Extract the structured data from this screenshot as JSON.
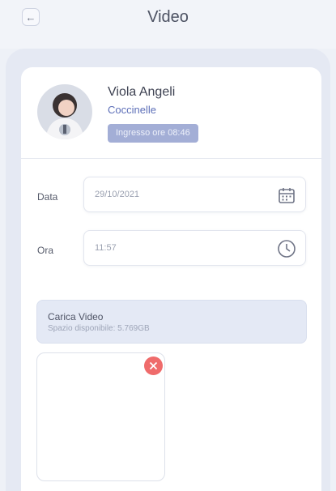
{
  "header": {
    "title": "Video",
    "back_icon": "arrow-left-icon"
  },
  "student": {
    "name": "Viola Angeli",
    "group": "Coccinelle",
    "entry_badge": "Ingresso ore 08:46"
  },
  "form": {
    "date_label": "Data",
    "date_value": "29/10/2021",
    "date_icon": "calendar-icon",
    "time_label": "Ora",
    "time_value": "11:57",
    "time_icon": "clock-icon"
  },
  "upload": {
    "title": "Carica Video",
    "available_space": "Spazio disponibile: 5.769GB",
    "remove_icon": "close-icon"
  },
  "colors": {
    "accent": "#5d6fb8",
    "badge": "#a3aed6",
    "remove": "#ef6b6b",
    "panel": "#e5e9f3"
  }
}
